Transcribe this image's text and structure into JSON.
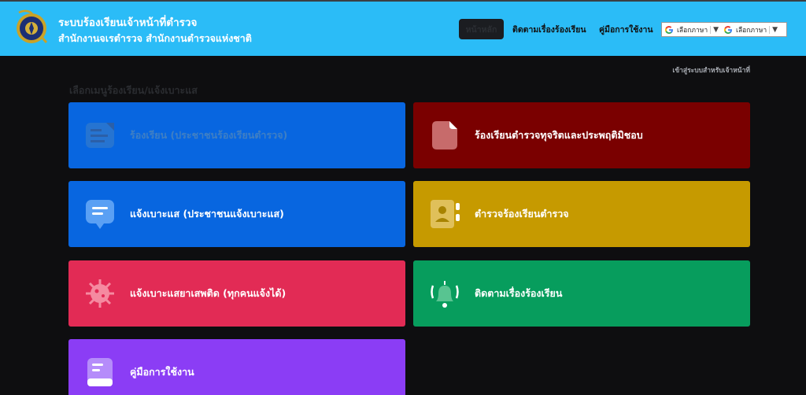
{
  "header": {
    "title": "ระบบร้องเรียนเจ้าหน้าที่ตำรวจ",
    "subtitle": "สำนักงานจเรตำรวจ สำนักงานตำรวจแห่งชาติ",
    "logo_icon": "police-emblem",
    "nav": {
      "home": "หน้าหลัก",
      "track": "ติดตามเรื่องร้องเรียน",
      "manual": "คู่มือการใช้งาน"
    },
    "language": {
      "select1": "เลือกภาษา",
      "select2": "เลือกภาษา",
      "caret": "▼"
    }
  },
  "officer_login": "เข้าสู่ระบบสำหรับเจ้าหน้าที่",
  "section_title": "เลือกเมนูร้องเรียน/แจ้งเบาะแส",
  "cards": [
    {
      "label": "ร้องเรียน (ประชาชนร้องเรียนตำรวจ)",
      "icon": "complaint-form-icon",
      "color": "#0866e0"
    },
    {
      "label": "ร้องเรียนตำรวจทุจริตและประพฤติมิชอบ",
      "icon": "document-icon",
      "color": "#7a0000"
    },
    {
      "label": "แจ้งเบาะแส (ประชาชนแจ้งเบาะแส)",
      "icon": "message-icon",
      "color": "#0866e0"
    },
    {
      "label": "ตำรวจร้องเรียนตำรวจ",
      "icon": "contact-book-icon",
      "color": "#c69a00"
    },
    {
      "label": "แจ้งเบาะแสยาเสพติด (ทุกคนแจ้งได้)",
      "icon": "virus-icon",
      "color": "#e22b55"
    },
    {
      "label": "ติดตามเรื่องร้องเรียน",
      "icon": "bell-icon",
      "color": "#079d5d"
    },
    {
      "label": "คู่มือการใช้งาน",
      "icon": "manual-icon",
      "color": "#8b3df5"
    }
  ]
}
